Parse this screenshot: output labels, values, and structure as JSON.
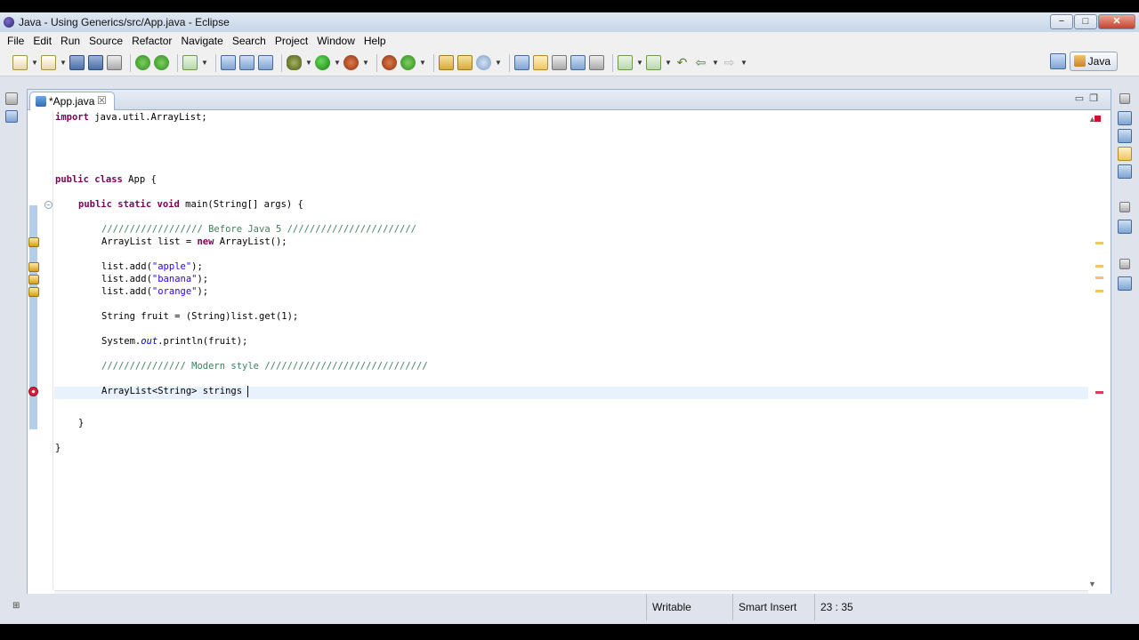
{
  "window": {
    "title": "Java - Using Generics/src/App.java - Eclipse",
    "minimize": "−",
    "maximize": "□",
    "close": "✕"
  },
  "menu": [
    "File",
    "Edit",
    "Run",
    "Source",
    "Refactor",
    "Navigate",
    "Search",
    "Project",
    "Window",
    "Help"
  ],
  "perspective": {
    "label": "Java"
  },
  "editor": {
    "tab_label": "*App.java",
    "tab_close": "☒",
    "code": {
      "import_kw": "import",
      "import_rest": " java.util.ArrayList;",
      "class_kw": "public class",
      "class_rest": " App {",
      "main_kw1": "public static void",
      "main_rest": " main(String[] args) {",
      "comment1": "////////////////// Before Java 5 ///////////////////////",
      "list_decl_a": "ArrayList list = ",
      "new_kw": "new",
      "list_decl_b": " ArrayList();",
      "add1_a": "list.add(",
      "add1_s": "\"apple\"",
      "add1_b": ");",
      "add2_a": "list.add(",
      "add2_s": "\"banana\"",
      "add2_b": ");",
      "add3_a": "list.add(",
      "add3_s": "\"orange\"",
      "add3_b": ");",
      "fruit_line": "String fruit = (String)list.get(1);",
      "print_a": "System.",
      "print_field": "out",
      "print_b": ".println(fruit);",
      "comment2": "/////////////// Modern style /////////////////////////////",
      "strings_line": "ArrayList<String> strings ",
      "close_method": "}",
      "close_class": "}"
    }
  },
  "status": {
    "writable": "Writable",
    "insert_mode": "Smart Insert",
    "position": "23 : 35"
  }
}
